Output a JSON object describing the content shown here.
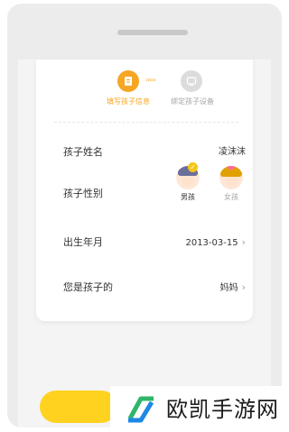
{
  "steps": [
    {
      "label": "填写孩子信息",
      "icon": "edit-form-icon",
      "active": true
    },
    {
      "label": "绑定孩子设备",
      "icon": "device-icon",
      "active": false
    }
  ],
  "steps_arrow": "›››››",
  "form": {
    "name_label": "孩子姓名",
    "name_value": "凌沫沫",
    "gender_label": "孩子性别",
    "gender_options": [
      {
        "label": "男孩",
        "selected": true
      },
      {
        "label": "女孩",
        "selected": false
      }
    ],
    "birth_label": "出生年月",
    "birth_value": "2013-03-15",
    "relation_label": "您是孩子的",
    "relation_value": "妈妈"
  },
  "chevron": "›",
  "watermark": {
    "text": "欧凯手游网"
  },
  "colors": {
    "accent": "#f5a623",
    "button": "#ffd21f",
    "logo_green": "#2fb56a",
    "logo_blue": "#1e88e5"
  }
}
